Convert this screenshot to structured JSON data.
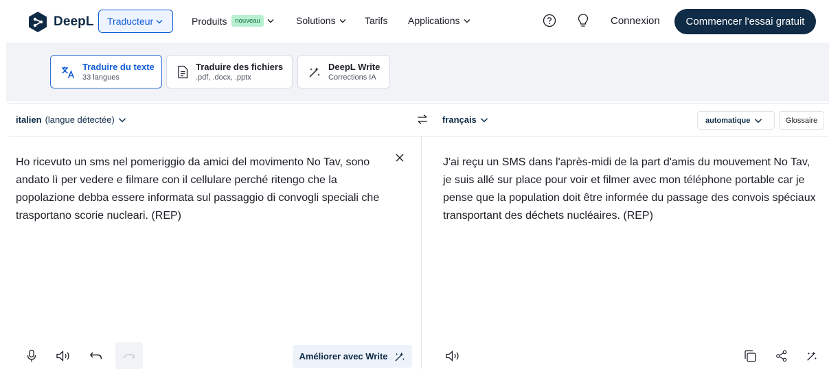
{
  "nav": {
    "logo_text": "DeepL",
    "traducteur_label": "Traducteur",
    "produits_label": "Produits",
    "produits_badge": "nouveau",
    "solutions_label": "Solutions",
    "tarifs_label": "Tarifs",
    "applications_label": "Applications",
    "connexion_label": "Connexion",
    "cta_label": "Commencer l'essai gratuit"
  },
  "modes": [
    {
      "title": "Traduire du texte",
      "subtitle": "33 langues",
      "active": true,
      "icon": "translate-icon"
    },
    {
      "title": "Traduire des fichiers",
      "subtitle": ".pdf, .docx, .pptx",
      "active": false,
      "icon": "document-icon"
    },
    {
      "title": "DeepL Write",
      "subtitle": "Corrections IA",
      "active": false,
      "icon": "magic-wand-icon"
    }
  ],
  "translator": {
    "source_lang": "italien",
    "source_lang_detected": "(langue détectée)",
    "target_lang": "français",
    "formality": "automatique",
    "glossary_label": "Glossaire",
    "source_text": "Ho ricevuto un sms nel pomeriggio da amici del movimento No Tav, sono andato lì per vedere e filmare con il cellulare perché ritengo che la popolazione debba essere informata sul passaggio di convogli speciali che trasportano scorie nucleari. (REP)",
    "target_text": "J'ai reçu un SMS dans l'après-midi de la part d'amis du mouvement No Tav, je suis allé sur place pour voir et filmer avec mon téléphone portable car je pense que la population doit être informée du passage des convois spéciaux transportant des déchets nucléaires. (REP)",
    "improve_label": "Améliorer avec Write"
  },
  "colors": {
    "brand_navy": "#0f2b46",
    "accent_blue": "#0f5bd6",
    "badge_green": "#b8f0d2",
    "band_gray": "#f1f3f7"
  }
}
